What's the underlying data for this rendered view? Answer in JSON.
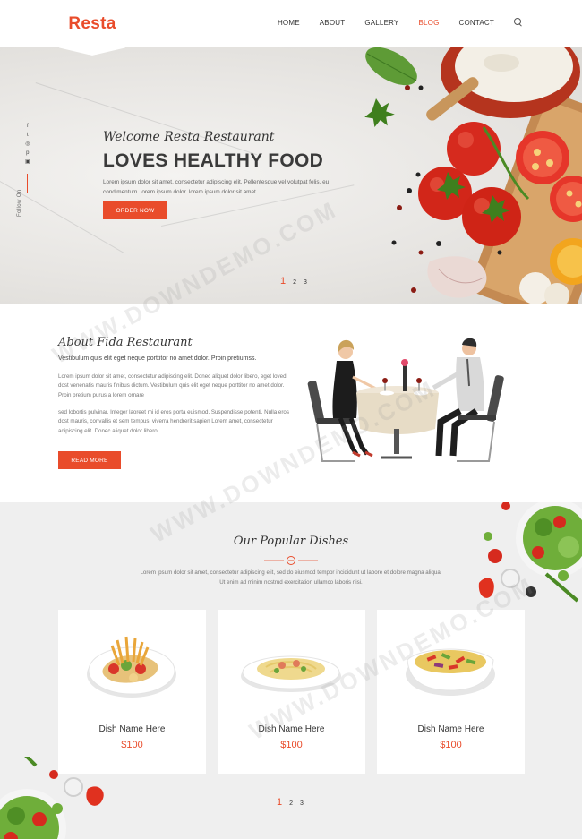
{
  "brand": {
    "name": "Resta",
    "accent_color": "#e94c2b"
  },
  "nav": {
    "items": [
      {
        "label": "HOME"
      },
      {
        "label": "ABOUT"
      },
      {
        "label": "GALLERY"
      },
      {
        "label": "BLOG",
        "active": true
      },
      {
        "label": "CONTACT"
      }
    ],
    "search_icon": "search-icon"
  },
  "hero": {
    "script": "Welcome Resta Restaurant",
    "title": "LOVES HEALTHY FOOD",
    "text": "Lorem ipsum dolor sit amet, consectetur adipiscing elit. Pellentesque vel volutpat felis, eu condimentum. lorem ipsum dolor. lorem ipsum dolor sit amet.",
    "button": "ORDER NOW",
    "social_icons": [
      "facebook-icon",
      "twitter-icon",
      "instagram-icon",
      "pinterest-icon",
      "rss-icon"
    ],
    "social_glyphs": [
      "f",
      "t",
      "◎",
      "p",
      "▣"
    ],
    "follow_label": "Follow On",
    "pager": [
      "1",
      "2",
      "3"
    ]
  },
  "about": {
    "script": "About Fida Restaurant",
    "subtitle": "Vestibulum quis elit eget neque porttitor no amet dolor. Proin pretiumss.",
    "paragraph1": "Lorem ipsum dolor sit amet, consectetur adipiscing elit. Donec aliquet dolor libero, eget loved dost venenatis mauris finibus dictum. Vestibulum quis elit eget neque porttitor no amet dolor. Proin pretium purus a lorem ornare",
    "paragraph2": "sed lobortis pulvinar. Integer laoreet mi id eros porta euismod. Suspendisse potenti. Nulla eros dost mauris, convallis et sem tempus, viverra hendrerit sapien Lorem amet, consectetur adipiscing elit. Donec aliquet dolor libero.",
    "button": "READ MORE"
  },
  "dishes": {
    "script": "Our Popular Dishes",
    "text": "Lorem ipsum dolor sit amet, consectetur adipiscing elit, sed do eiusmod tempor incididunt ut labore et dolore magna aliqua. Ut enim ad minim nostrud exercitation ullamco laboris nisi.",
    "items": [
      {
        "name": "Dish Name Here",
        "price": "$100"
      },
      {
        "name": "Dish Name Here",
        "price": "$100"
      },
      {
        "name": "Dish Name Here",
        "price": "$100"
      }
    ],
    "pager": [
      "1",
      "2",
      "3"
    ]
  },
  "watermark": "WWW.DOWNDEMO.COM"
}
